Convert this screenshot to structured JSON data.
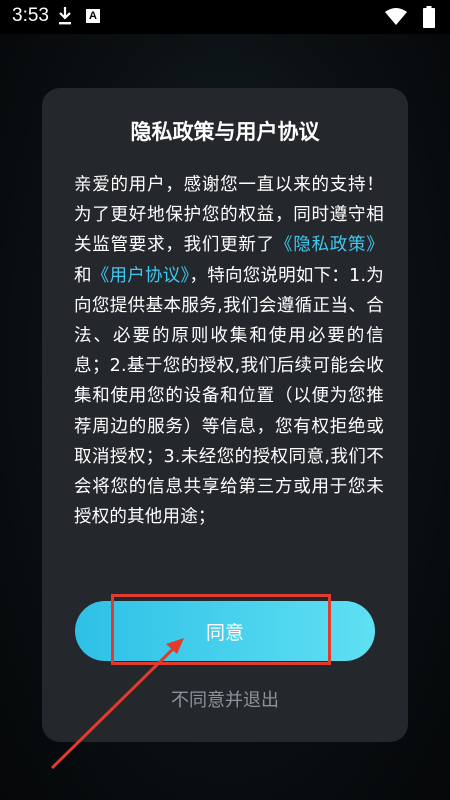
{
  "status_bar": {
    "time": "3:53",
    "icons": [
      "download-icon",
      "a-notification-icon",
      "wifi-icon",
      "battery-icon"
    ],
    "a_icon_label": "A"
  },
  "dialog": {
    "title": "隐私政策与用户协议",
    "body": {
      "p1": "亲爱的用户，感谢您一直以来的支持！为了更好地保护您的权益，同时遵守相关监管要求，我们更新了",
      "privacy_link": "《隐私政策》",
      "and": "和",
      "agreement_link": "《用户协议》",
      "p2": "，特向您说明如下：1.为向您提供基本服务,我们会遵循正当、合法、必要的原则收集和使用必要的信息；2.基于您的授权,我们后续可能会收集和使用您的设备和位置（以便为您推荐周边的服务）等信息，您有权拒绝或取消授权；3.未经您的授权同意,我们不会将您的信息共享给第三方或用于您未授权的其他用途；"
    },
    "agree_label": "同意",
    "disagree_label": "不同意并退出"
  },
  "colors": {
    "link": "#3fc9f0",
    "button_gradient_start": "#2ec0e6",
    "button_gradient_end": "#5fe0f3",
    "annotation_red": "#e03b2c",
    "dialog_bg": "#24282c"
  }
}
